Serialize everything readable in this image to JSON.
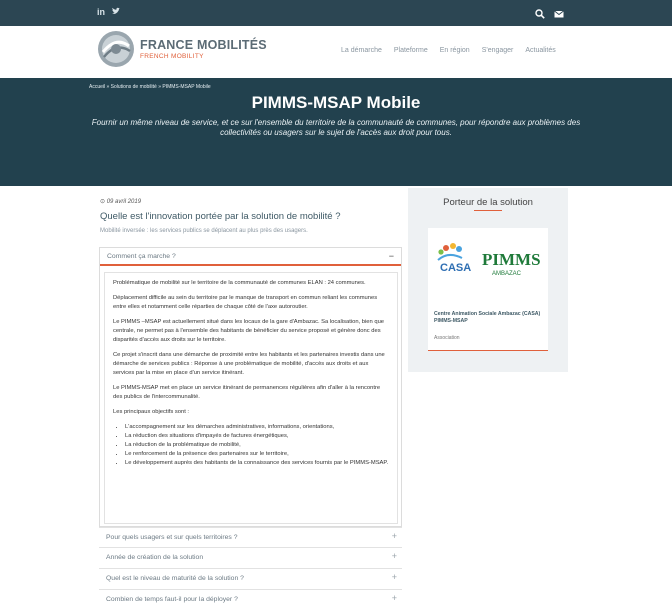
{
  "topbar": {
    "social": [
      {
        "label": "in",
        "icon": "linkedin-icon"
      },
      {
        "label": "🐦",
        "icon": "twitter-icon"
      }
    ],
    "tools": [
      {
        "icon": "search-icon"
      },
      {
        "icon": "mail-icon"
      }
    ]
  },
  "header": {
    "brand_name": "FRANCE MOBILITÉS",
    "brand_sub": "FRENCH MOBILITY",
    "nav": [
      "La démarche",
      "Plateforme",
      "En région",
      "S'engager",
      "Actualités"
    ]
  },
  "hero": {
    "breadcrumb": "Accueil » Solutions de mobilité » PIMMS-MSAP Mobile",
    "title": "PIMMS-MSAP Mobile",
    "description": "Fournir un même niveau de service, et ce sur l'ensemble du territoire de la communauté de communes, pour répondre aux problèmes des collectivités ou usagers sur le sujet de l'accès aux droit pour tous."
  },
  "main": {
    "date": "09 avril 2019",
    "question": "Quelle est l'innovation portée par la solution de mobilité ?",
    "subquestion": "Mobilité inversée : les services publics se déplacent au plus près des usagers.",
    "accordion_open": {
      "title": "Comment ça marche ?",
      "toggle": "−",
      "paragraphs": [
        "Problématique de mobilité sur le territoire de la communauté de communes ELAN : 24 communes.",
        "Déplacement difficile au sein du territoire par le manque de transport en commun reliant les communes entre elles et notamment celle réparties de chaque côté de l'axe autoroutier.",
        "Le PIMMS –MSAP est actuellement situé dans les locaux de la gare d'Ambazac. Sa localisation, bien que centrale, ne permet pas à l'ensemble des habitants de bénéficier du service proposé et génère donc des disparités d'accès aux droits sur le territoire.",
        "Ce projet s'inscrit dans une démarche de proximité entre les habitants et les partenaires investis dans une démarche de services publics : Réponse à une problématique de mobilité, d'accès aux droits et aux services par la mise en place d'un service itinérant.",
        "Le PIMMS-MSAP met en place un service itinérant de permanences régulières afin d'aller à la rencontre des publics de l'intercommunalité.",
        "Les principaux objectifs sont :"
      ],
      "objectives": [
        "L'accompagnement sur les démarches administratives, informations, orientations,",
        "La réduction des situations d'impayés de factures énergétiques,",
        "La réduction de la problématique de mobilité,",
        "Le renforcement de la présence des partenaires sur le territoire,",
        "Le développement auprès des habitants de la connaissance des services fournis par le PIMMS-MSAP."
      ]
    },
    "accordion_closed": [
      {
        "title": "Pour quels usagers et sur quels territoires ?",
        "toggle": "+"
      },
      {
        "title": "Année de création de la solution",
        "toggle": "+"
      },
      {
        "title": "Quel est le niveau de maturité de la solution ?",
        "toggle": "+"
      },
      {
        "title": "Combien de temps faut-il pour la déployer ?",
        "toggle": "+"
      }
    ]
  },
  "porteur": {
    "title": "Porteur de la solution",
    "logo_text_left": "CASA",
    "logo_text_right": "PIMMS",
    "logo_text_right_sub": "AMBAZAC",
    "name": "Centre Animation Sociale Ambazac (CASA) PIMMS-MSAP",
    "type": "Association"
  },
  "colors": {
    "topbar": "#2c4653",
    "hero": "#22414e",
    "accent": "#e0603b",
    "pimms_green": "#1f7a3a",
    "sidebar_bg": "#eef1f3"
  }
}
